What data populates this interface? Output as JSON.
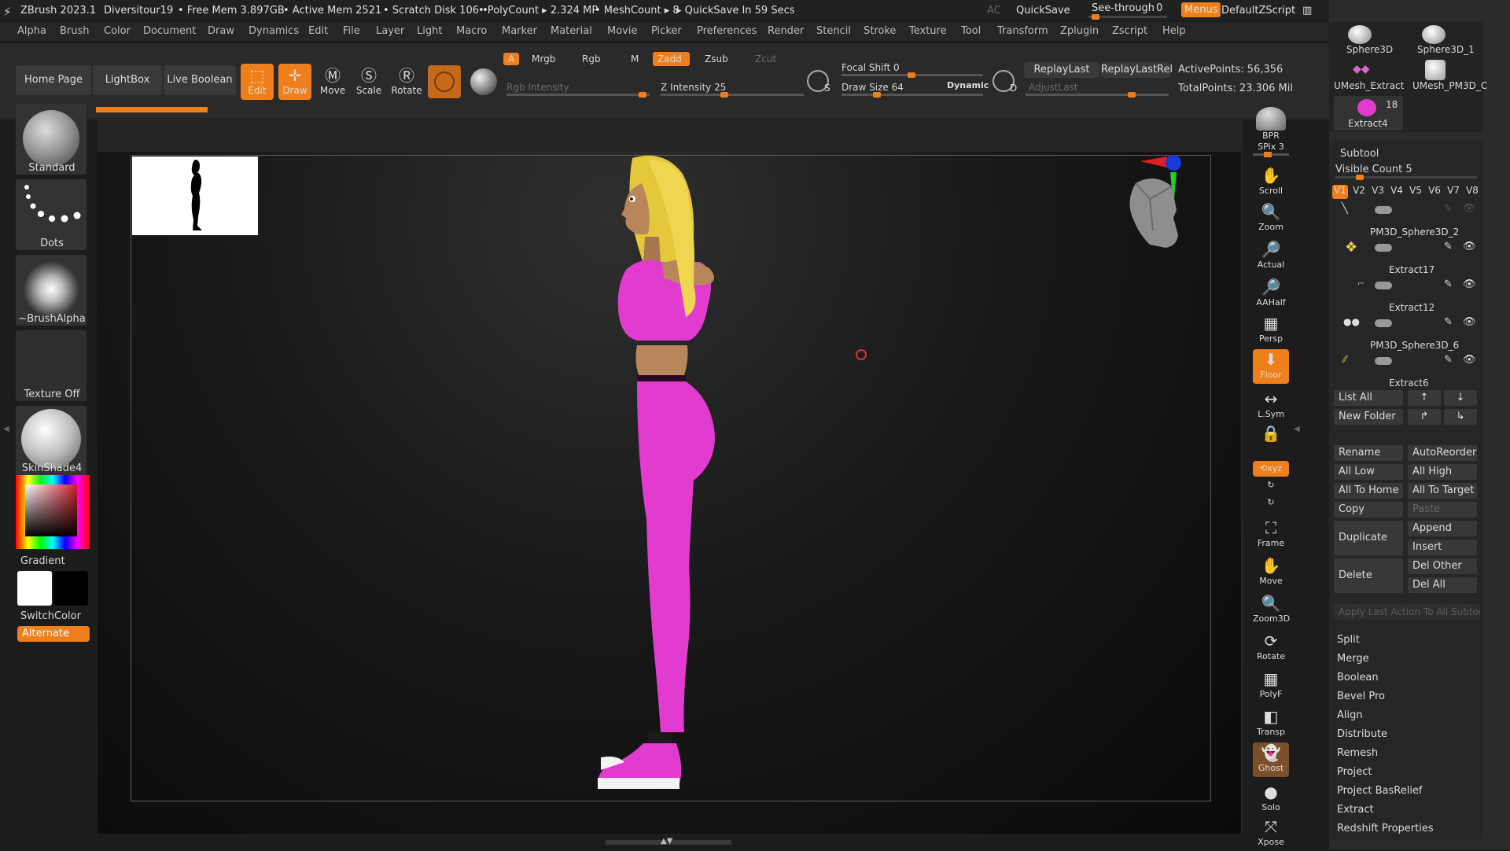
{
  "titlebar": {
    "app": "ZBrush 2023.1",
    "doc": "Diversitour19",
    "free_mem": "• Free Mem 3.897GB",
    "active_mem": "• Active Mem 2521",
    "scratch": "• Scratch Disk 106 •",
    "polycount": "• PolyCount ▸ 2.324 MP",
    "meshcount": "• MeshCount ▸ 8",
    "quicksave_in": "▸ QuickSave In 59 Secs",
    "ac": "AC",
    "quicksave": "QuickSave",
    "see_through": "See-through",
    "see_through_val": "0",
    "menus": "Menus",
    "script": "DefaultZScript"
  },
  "menubar": [
    "Alpha",
    "Brush",
    "Color",
    "Document",
    "Draw",
    "Dynamics",
    "Edit",
    "File",
    "Layer",
    "Light",
    "Macro",
    "Marker",
    "Material",
    "Movie",
    "Picker",
    "Preferences",
    "Render",
    "Stencil",
    "Stroke",
    "Texture",
    "Tool",
    "Transform",
    "Zplugin",
    "Zscript",
    "Help"
  ],
  "shelf": {
    "home": "Home Page",
    "lightbox": "LightBox",
    "live_boolean": "Live Boolean",
    "edit": "Edit",
    "draw": "Draw",
    "move": "Move",
    "scale": "Scale",
    "rotate": "Rotate",
    "a": "A",
    "mrgb": "Mrgb",
    "rgb": "Rgb",
    "m": "M",
    "zadd": "Zadd",
    "zsub": "Zsub",
    "zcut": "Zcut",
    "rgb_intensity": "Rgb Intensity",
    "z_intensity": "Z Intensity 25",
    "focal_shift": "Focal Shift 0",
    "draw_size": "Draw Size 64",
    "dynamic": "Dynamic",
    "replay_last": "ReplayLast",
    "replay_last_rel": "ReplayLastRel",
    "adjust_last": "AdjustLast",
    "active_points": "ActivePoints: 56,356",
    "total_points": "TotalPoints: 23.306 Mil",
    "s": "S",
    "d": "D"
  },
  "left": {
    "brush": "Standard",
    "stroke": "Dots",
    "alpha": "~BrushAlpha",
    "texture": "Texture Off",
    "material": "SkinShade4",
    "gradient": "Gradient",
    "switch": "SwitchColor",
    "alternate": "Alternate"
  },
  "rightcol": [
    "BPR",
    "SPix 3",
    "Scroll",
    "Zoom",
    "Actual",
    "AAHalf",
    "Persp",
    "Floor",
    "L.Sym",
    "",
    "Frame",
    "Move",
    "Zoom3D",
    "Rotate",
    "PolyF",
    "Transp",
    "Ghost",
    "Solo",
    "Xpose"
  ],
  "subtool": {
    "thumbs": [
      "Sphere3D",
      "Sphere3D_1",
      "UMesh_Extract",
      "UMesh_PM3D_C",
      "Extract4"
    ],
    "extract_count": "18",
    "title": "Subtool",
    "visible_count": "Visible Count 5",
    "vtabs": [
      "V1",
      "V2",
      "V3",
      "V4",
      "V5",
      "V6",
      "V7",
      "V8"
    ],
    "items": [
      "PM3D_Sphere3D_2",
      "Extract17",
      "Extract12",
      "PM3D_Sphere3D_6",
      "Extract6"
    ],
    "list_all": "List All",
    "new_folder": "New Folder",
    "rename": "Rename",
    "autoreorder": "AutoReorder",
    "all_low": "All Low",
    "all_high": "All High",
    "all_to_home": "All To Home",
    "all_to_target": "All To Target",
    "copy": "Copy",
    "paste": "Paste",
    "duplicate": "Duplicate",
    "append": "Append",
    "insert": "Insert",
    "delete": "Delete",
    "del_other": "Del Other",
    "del_all": "Del All",
    "apply_last": "Apply Last Action To All Subtoo",
    "sections": [
      "Split",
      "Merge",
      "Boolean",
      "Bevel Pro",
      "Align",
      "Distribute",
      "Remesh",
      "Project",
      "Project BasRelief",
      "Extract",
      "Redshift Properties"
    ]
  },
  "colors": {
    "accent": "#ef7f1a",
    "pink": "#e23bd0",
    "hair": "#e8d24a",
    "skin": "#b8865a"
  }
}
